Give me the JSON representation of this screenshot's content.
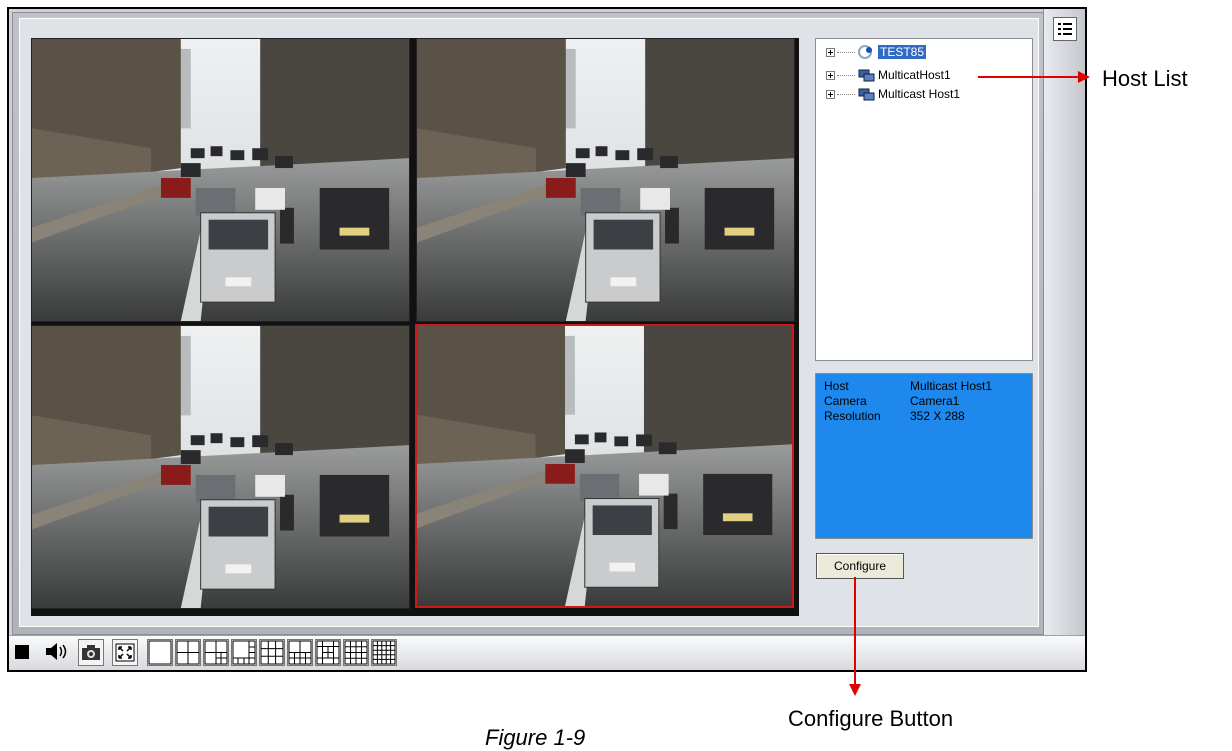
{
  "host_tree": {
    "items": [
      {
        "label": "TEST85",
        "selected": true,
        "icon": "server-globe-icon"
      },
      {
        "label": "MulticatHost1",
        "selected": false,
        "icon": "multicast-host-icon"
      },
      {
        "label": "Multicast Host1",
        "selected": false,
        "icon": "multicast-host-icon"
      }
    ]
  },
  "info": {
    "rows": [
      {
        "key": "Host",
        "value": "Multicast Host1"
      },
      {
        "key": "Camera",
        "value": "Camera1"
      },
      {
        "key": "Resolution",
        "value": "352 X 288"
      }
    ]
  },
  "configure_label": "Configure",
  "toolbar": {
    "buttons": [
      "stop-icon",
      "speaker-icon",
      "camera-snapshot-icon",
      "fullscreen-icon",
      "layout-1-icon",
      "layout-4-icon",
      "layout-6-icon",
      "layout-8-icon",
      "layout-9-icon",
      "layout-10-icon",
      "layout-13-icon",
      "layout-16-icon",
      "layout-25-icon"
    ]
  },
  "callouts": {
    "host_list": "Host List",
    "configure_button": "Configure Button",
    "figure_caption": "Figure 1-9"
  },
  "colors": {
    "info_bg": "#1e88ec",
    "selection": "#316ac5",
    "active_view_border": "#d01818",
    "callout_arrow": "#e00000"
  },
  "video_grid": {
    "rows": 2,
    "cols": 2,
    "active_index": 3
  }
}
